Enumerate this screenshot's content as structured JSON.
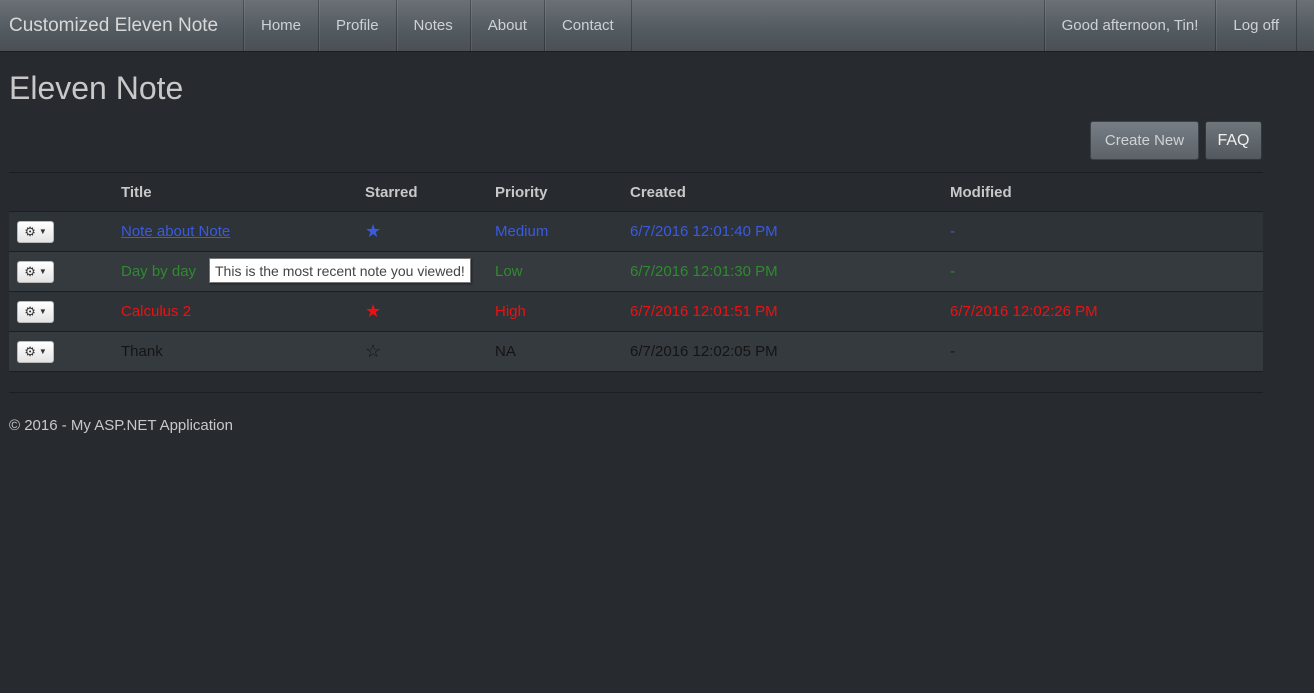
{
  "navbar": {
    "brand": "Customized Eleven Note",
    "links": [
      "Home",
      "Profile",
      "Notes",
      "About",
      "Contact"
    ],
    "greeting": "Good afternoon, Tin!",
    "logoff": "Log off"
  },
  "page": {
    "title": "Eleven Note",
    "create_label": "Create New",
    "faq_label": "FAQ"
  },
  "table": {
    "headers": [
      "Title",
      "Starred",
      "Priority",
      "Created",
      "Modified"
    ],
    "rows": [
      {
        "title": "Note about Note",
        "starred": "★",
        "priority": "Medium",
        "created": "6/7/2016 12:01:40 PM",
        "modified": "-",
        "color": "#3a5ae0"
      },
      {
        "title": "Day by day",
        "starred": "",
        "priority": "Low",
        "created": "6/7/2016 12:01:30 PM",
        "modified": "-",
        "color": "#2e8b2e"
      },
      {
        "title": "Calculus 2",
        "starred": "★",
        "priority": "High",
        "created": "6/7/2016 12:01:51 PM",
        "modified": "6/7/2016 12:02:26 PM",
        "color": "#ee1111"
      },
      {
        "title": "Thank",
        "starred": "☆",
        "priority": "NA",
        "created": "6/7/2016 12:02:05 PM",
        "modified": "-",
        "color": "#141414"
      }
    ],
    "action_icon": "gear-icon"
  },
  "tooltip": "This is the most recent note you viewed!",
  "footer": "© 2016 - My ASP.NET Application"
}
